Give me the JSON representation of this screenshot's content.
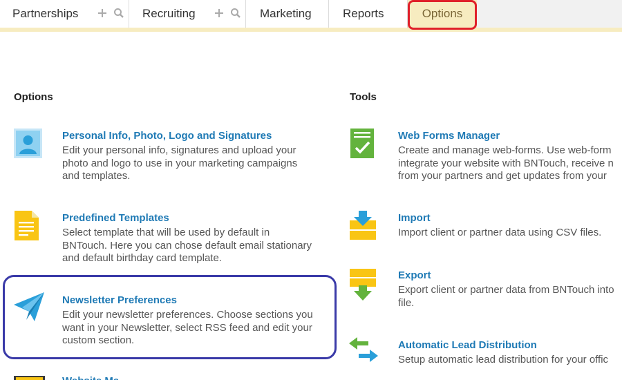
{
  "nav": {
    "tabs": [
      {
        "label": "Partnerships",
        "has_tools": true
      },
      {
        "label": "Recruiting",
        "has_tools": true
      },
      {
        "label": "Marketing",
        "has_tools": false
      },
      {
        "label": "Reports",
        "has_tools": false
      },
      {
        "label": "Options",
        "active": true
      }
    ],
    "tool_icons": [
      "plus-icon",
      "search-icon"
    ]
  },
  "options": {
    "heading": "Options",
    "items": [
      {
        "title": "Personal Info, Photo, Logo and Signatures",
        "desc": [
          "Edit your personal info, signatures and upload your",
          "photo and logo to use in your marketing campaigns",
          "and templates."
        ],
        "icon": "person-icon"
      },
      {
        "title": "Predefined Templates",
        "desc": [
          "Select template that will be used by default in",
          "BNTouch. Here you can chose default email stationary",
          "and default birthday card template."
        ],
        "icon": "document-icon"
      },
      {
        "title": "Newsletter Preferences",
        "desc": [
          "Edit your newsletter preferences. Choose sections you",
          "want in your Newsletter, select RSS feed and edit your",
          "custom section."
        ],
        "icon": "paper-plane-icon"
      },
      {
        "title": "Website Ma",
        "icon": "website-icon"
      }
    ]
  },
  "tools": {
    "heading": "Tools",
    "items": [
      {
        "title": "Web Forms Manager",
        "desc": [
          "Create and manage web-forms. Use web-form",
          "integrate your website with BNTouch, receive n",
          "from your partners and get updates from your"
        ],
        "icon": "form-check-icon"
      },
      {
        "title": "Import",
        "desc": [
          "Import client or partner data using CSV files."
        ],
        "icon": "import-icon"
      },
      {
        "title": "Export",
        "desc": [
          "Export client or partner data from BNTouch into",
          "file."
        ],
        "icon": "export-icon"
      },
      {
        "title": "Automatic Lead Distribution",
        "desc": [
          "Setup automatic lead distribution for your offic"
        ],
        "icon": "swap-arrows-icon"
      }
    ]
  },
  "colors": {
    "link": "#1f7ab5",
    "accent_bar": "#f7ecc0",
    "options_ring": "#e0202a",
    "highlight_ring": "#3a3aa8"
  }
}
